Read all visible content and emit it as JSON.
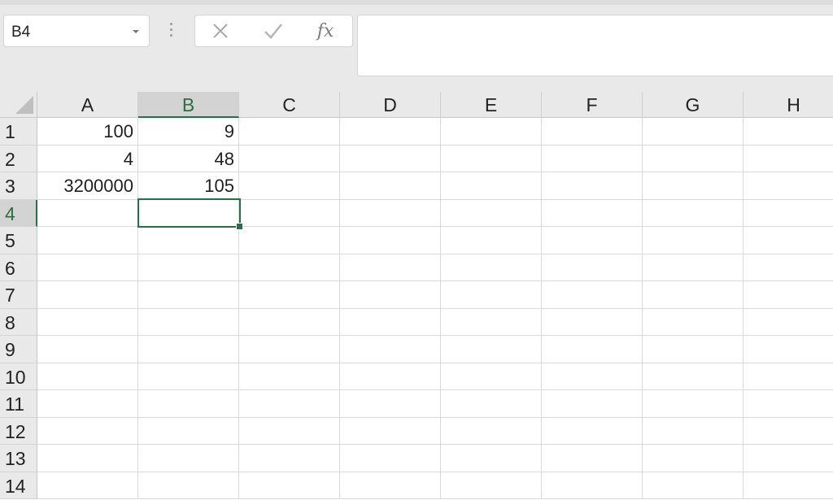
{
  "name_box": {
    "value": "B4"
  },
  "formula_buttons": {
    "cancel": "✕",
    "enter": "✓",
    "fx": "fx"
  },
  "formula_bar": {
    "value": ""
  },
  "columns": [
    "A",
    "B",
    "C",
    "D",
    "E",
    "F",
    "G",
    "H"
  ],
  "selected_column": "B",
  "rows": [
    "1",
    "2",
    "3",
    "4",
    "5",
    "6",
    "7",
    "8",
    "9",
    "10",
    "11",
    "12",
    "13",
    "14"
  ],
  "selected_row": "4",
  "cells": {
    "A1": "100",
    "B1": "9",
    "A2": "4",
    "B2": "48",
    "A3": "3200000",
    "B3": "105"
  },
  "active_cell": "B4",
  "colors": {
    "accent": "#217346",
    "header_bg": "#e9e9e9",
    "grid_line": "#dadada"
  }
}
